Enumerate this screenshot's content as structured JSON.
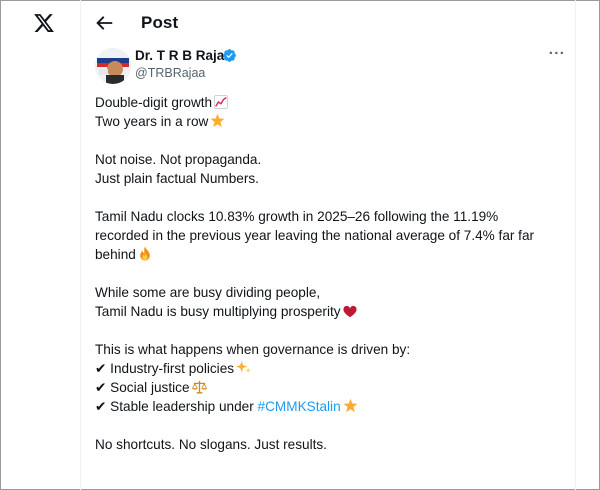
{
  "header": {
    "title": "Post"
  },
  "post": {
    "author_name": "Dr. T R B Rajaa",
    "author_handle": "@TRBRajaa",
    "lines": {
      "l1": "Double-digit growth",
      "l2": "Two years in a row",
      "l3": "Not noise. Not propaganda.",
      "l4": "Just plain factual Numbers.",
      "l5": "Tamil Nadu clocks 10.83% growth in 2025–26 following the 11.19%",
      "l6": "recorded in the previous year leaving the national average of 7.4% far far",
      "l7": "behind",
      "l8": "While some are busy dividing people,",
      "l9": "Tamil Nadu is busy multiplying prosperity",
      "l10": "This is what happens when governance is driven by:",
      "l11_check": "✔",
      "l11": "Industry-first policies",
      "l12_check": "✔",
      "l12": "Social justice",
      "l13_check": "✔",
      "l13": "Stable leadership under ",
      "hashtag": "#CMMKStalin",
      "l14": "No shortcuts. No slogans. Just results."
    },
    "more_glyph": "···"
  },
  "icons": {
    "logo": "x-logo-icon",
    "back": "arrow-left-icon",
    "verified": "verified-badge-icon",
    "chart": "chart-increasing-emoji",
    "star": "glowing-star-emoji",
    "fire": "fire-emoji",
    "heart": "red-heart-emoji",
    "sparkles": "sparkles-emoji",
    "scales": "balance-scale-emoji"
  },
  "colors": {
    "link": "#1d9bf0",
    "verified": "#1d9bf0",
    "text": "#0f1419",
    "muted": "#536471"
  }
}
